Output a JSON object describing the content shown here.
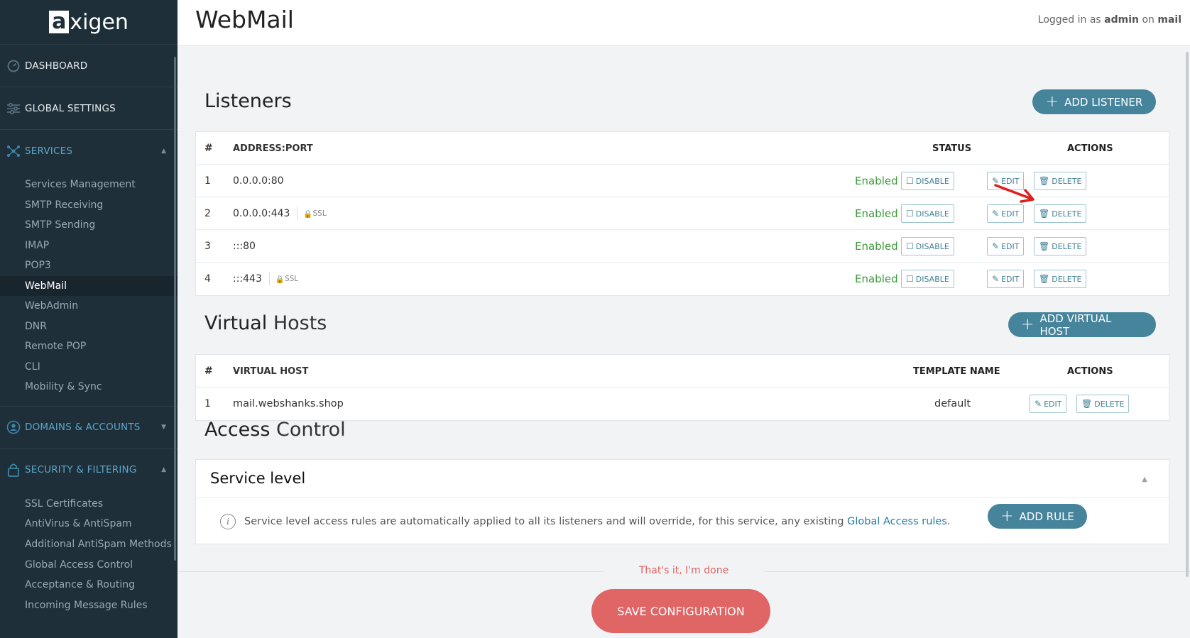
{
  "app": {
    "brand_a": "a",
    "brand_rest": "xigen"
  },
  "header": {
    "title": "WebMail",
    "login_prefix": "Logged in as",
    "login_user": "admin",
    "login_mid": "on",
    "login_host": "mail"
  },
  "sidebar": {
    "dashboard": "DASHBOARD",
    "global_settings": "GLOBAL SETTINGS",
    "services": "SERVICES",
    "services_items": [
      "Services Management",
      "SMTP Receiving",
      "SMTP Sending",
      "IMAP",
      "POP3",
      "WebMail",
      "WebAdmin",
      "DNR",
      "Remote POP",
      "CLI",
      "Mobility & Sync"
    ],
    "domains_accounts": "DOMAINS & ACCOUNTS",
    "security_filtering": "SECURITY & FILTERING",
    "security_items": [
      "SSL Certificates",
      "AntiVirus & AntiSpam",
      "Additional AntiSpam Methods",
      "Global Access Control",
      "Acceptance & Routing",
      "Incoming Message Rules"
    ]
  },
  "listeners": {
    "title": "Listeners",
    "add_label": "ADD LISTENER",
    "col_num": "#",
    "col_addr": "ADDRESS:PORT",
    "col_status": "STATUS",
    "col_actions": "ACTIONS",
    "rows": [
      {
        "num": "1",
        "addr": "0.0.0.0:80",
        "ssl": "",
        "status": "Enabled"
      },
      {
        "num": "2",
        "addr": "0.0.0.0:443",
        "ssl": "SSL",
        "status": "Enabled"
      },
      {
        "num": "3",
        "addr": ":::80",
        "ssl": "",
        "status": "Enabled"
      },
      {
        "num": "4",
        "addr": ":::443",
        "ssl": "SSL",
        "status": "Enabled"
      }
    ],
    "disable_label": "DISABLE",
    "edit_label": "EDIT",
    "delete_label": "DELETE"
  },
  "virtual_hosts": {
    "title_a": "Virtual",
    "title_b": "Hosts",
    "add_label": "ADD VIRTUAL HOST",
    "col_num": "#",
    "col_host": "VIRTUAL HOST",
    "col_template": "TEMPLATE NAME",
    "col_actions": "ACTIONS",
    "rows": [
      {
        "num": "1",
        "host": "mail.webshanks.shop",
        "template": "default"
      }
    ]
  },
  "access_control": {
    "title_a": "Access",
    "title_b": "Control",
    "panel_title": "Service level",
    "info_text": "Service level access rules are automatically applied to all its listeners and will override, for this service, any existing",
    "info_link": "Global Access rules",
    "info_end": ".",
    "add_rule_label": "ADD RULE"
  },
  "footer": {
    "done_text": "That's it, I'm done",
    "save_label": "SAVE CONFIGURATION"
  },
  "colors": {
    "sidebar_bg": "#1f2f39",
    "accent": "#46849c",
    "enabled": "#3d9a3a",
    "save": "#e06565",
    "annotation_arrow": "#e01e1e"
  }
}
